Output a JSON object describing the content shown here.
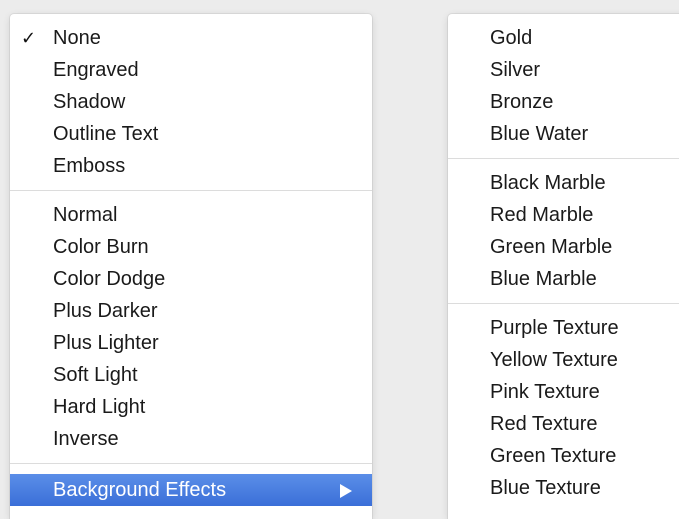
{
  "menu_left": {
    "group1": [
      {
        "label": "None",
        "checked": true
      },
      {
        "label": "Engraved"
      },
      {
        "label": "Shadow"
      },
      {
        "label": "Outline Text"
      },
      {
        "label": "Emboss"
      }
    ],
    "group2": [
      {
        "label": "Normal"
      },
      {
        "label": "Color Burn"
      },
      {
        "label": "Color Dodge"
      },
      {
        "label": "Plus Darker"
      },
      {
        "label": "Plus Lighter"
      },
      {
        "label": "Soft Light"
      },
      {
        "label": "Hard Light"
      },
      {
        "label": "Inverse"
      }
    ],
    "submenu_item": {
      "label": "Background Effects",
      "highlighted": true
    },
    "check_glyph": "✓"
  },
  "menu_right": {
    "group1": [
      "Gold",
      "Silver",
      "Bronze",
      "Blue Water"
    ],
    "group2": [
      "Black Marble",
      "Red Marble",
      "Green Marble",
      "Blue Marble"
    ],
    "group3": [
      "Purple Texture",
      "Yellow Texture",
      "Pink Texture",
      "Red Texture",
      "Green Texture",
      "Blue Texture"
    ]
  },
  "colors": {
    "highlight": "#3b6fd8",
    "menu_bg": "#ffffff",
    "separator": "#dcdcdc"
  }
}
